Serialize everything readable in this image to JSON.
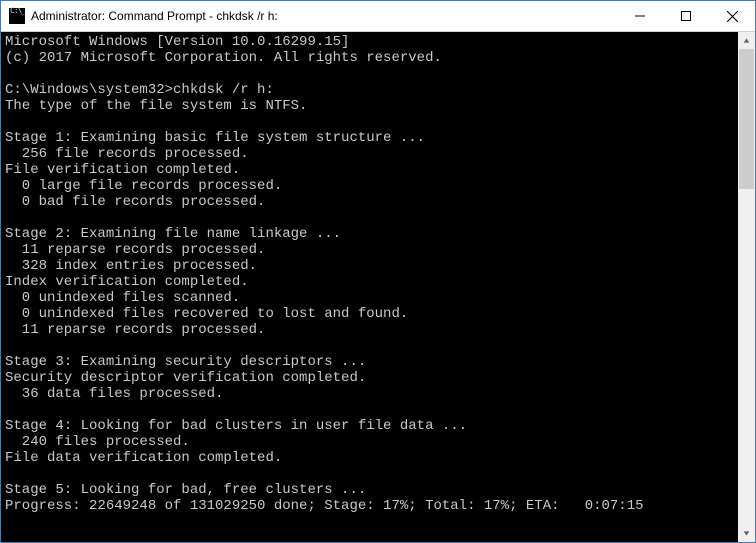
{
  "window": {
    "title": "Administrator: Command Prompt - chkdsk  /r h:"
  },
  "terminal": {
    "lines": [
      "Microsoft Windows [Version 10.0.16299.15]",
      "(c) 2017 Microsoft Corporation. All rights reserved.",
      "",
      "C:\\Windows\\system32>chkdsk /r h:",
      "The type of the file system is NTFS.",
      "",
      "Stage 1: Examining basic file system structure ...",
      "  256 file records processed.",
      "File verification completed.",
      "  0 large file records processed.",
      "  0 bad file records processed.",
      "",
      "Stage 2: Examining file name linkage ...",
      "  11 reparse records processed.",
      "  328 index entries processed.",
      "Index verification completed.",
      "  0 unindexed files scanned.",
      "  0 unindexed files recovered to lost and found.",
      "  11 reparse records processed.",
      "",
      "Stage 3: Examining security descriptors ...",
      "Security descriptor verification completed.",
      "  36 data files processed.",
      "",
      "Stage 4: Looking for bad clusters in user file data ...",
      "  240 files processed.",
      "File data verification completed.",
      "",
      "Stage 5: Looking for bad, free clusters ...",
      "Progress: 22649248 of 131029250 done; Stage: 17%; Total: 17%; ETA:   0:07:15"
    ]
  }
}
